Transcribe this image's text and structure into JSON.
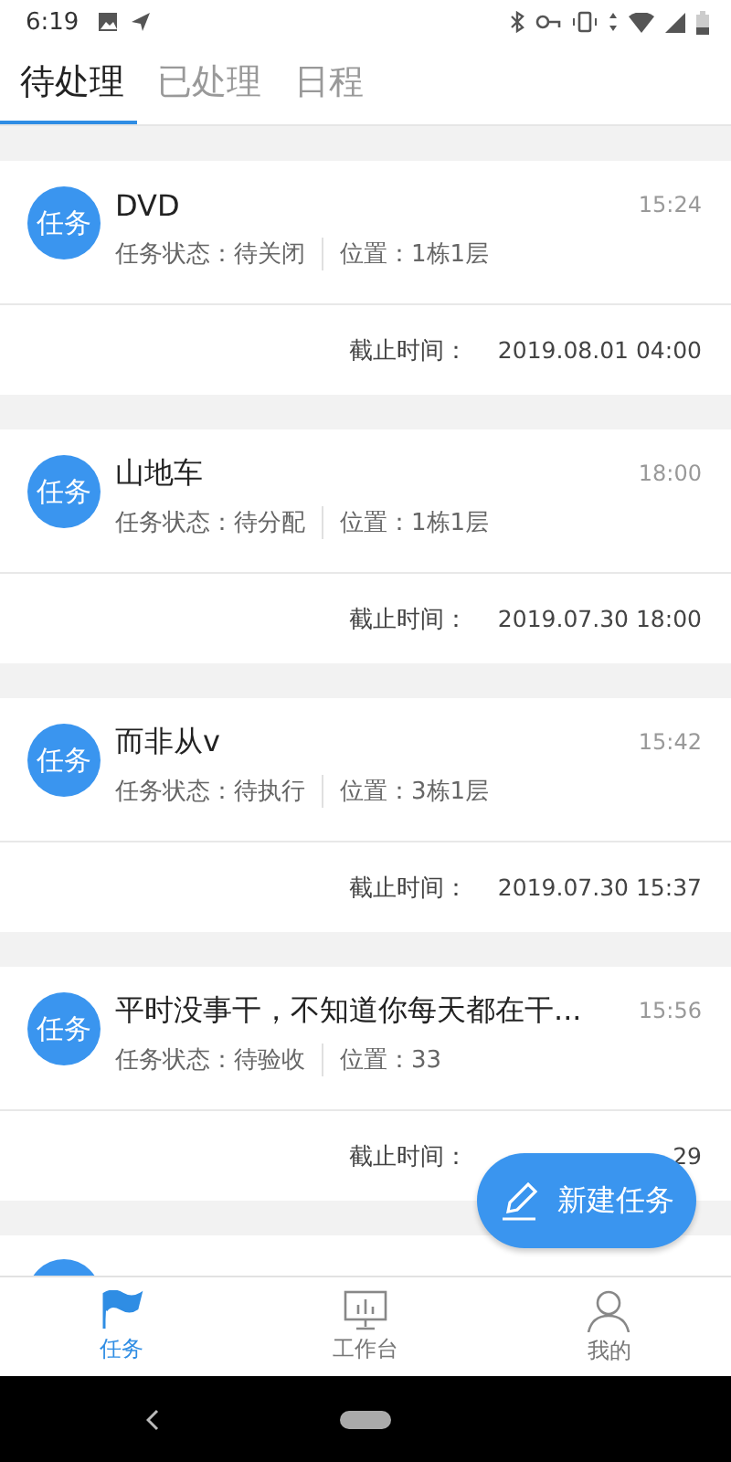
{
  "status_bar": {
    "time": "6:19"
  },
  "tabs": [
    {
      "label": "待处理",
      "selected": true
    },
    {
      "label": "已处理",
      "selected": false
    },
    {
      "label": "日程",
      "selected": false
    }
  ],
  "tasks": [
    {
      "badge": "任务",
      "title": "DVD",
      "time": "15:24",
      "status": "任务状态：待关闭",
      "location": "位置：1栋1层",
      "deadline_label": "截止时间：",
      "deadline": "2019.08.01 04:00"
    },
    {
      "badge": "任务",
      "title": "山地车",
      "time": "18:00",
      "status": "任务状态：待分配",
      "location": "位置：1栋1层",
      "deadline_label": "截止时间：",
      "deadline": "2019.07.30 18:00"
    },
    {
      "badge": "任务",
      "title": "而非从v",
      "time": "15:42",
      "status": "任务状态：待执行",
      "location": "位置：3栋1层",
      "deadline_label": "截止时间：",
      "deadline": "2019.07.30 15:37"
    },
    {
      "badge": "任务",
      "title": "平时没事干，不知道你每天都在干...",
      "time": "15:56",
      "status": "任务状态：待验收",
      "location": "位置：33",
      "deadline_label": "截止时间：",
      "deadline": "29"
    }
  ],
  "more_below": true,
  "fab": {
    "label": "新建任务"
  },
  "bottom_nav": [
    {
      "label": "任务",
      "selected": true,
      "kind": "flag"
    },
    {
      "label": "工作台",
      "selected": false,
      "kind": "monitor"
    },
    {
      "label": "我的",
      "selected": false,
      "kind": "person"
    }
  ]
}
